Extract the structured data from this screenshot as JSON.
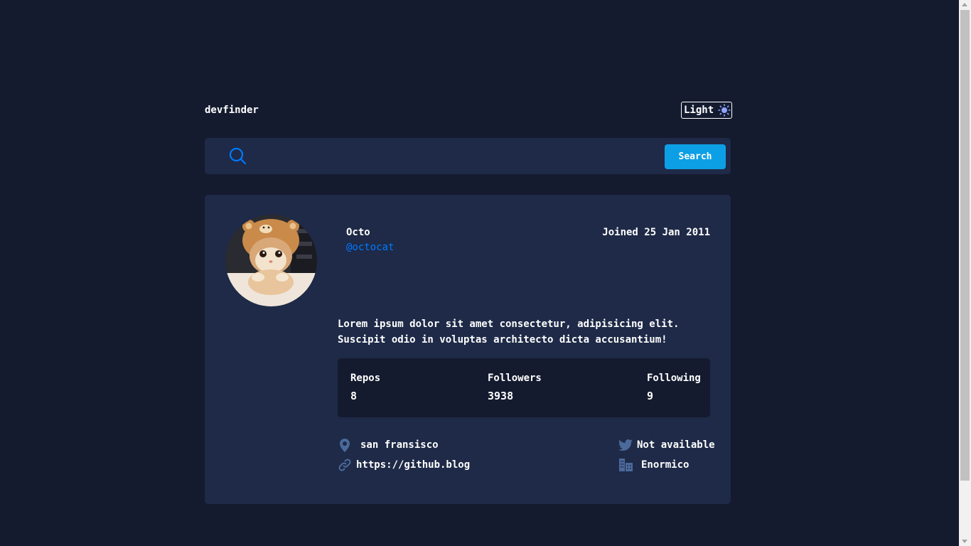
{
  "header": {
    "logo": "devfinder",
    "theme_toggle_label": "Light"
  },
  "search": {
    "value": "",
    "placeholder": "",
    "button_label": "Search"
  },
  "profile": {
    "name": "Octo",
    "login": "@octocat",
    "joined": "Joined 25 Jan 2011",
    "bio": "Lorem ipsum dolor sit amet consectetur, adipisicing elit. Suscipit odio in voluptas architecto dicta accusantium!",
    "stats": {
      "repos_label": "Repos",
      "repos_value": "8",
      "followers_label": "Followers",
      "followers_value": "3938",
      "following_label": "Following",
      "following_value": "9"
    },
    "links": {
      "location": "san fransisco",
      "blog": "https://github.blog",
      "twitter": "Not available",
      "company": "Enormico"
    }
  },
  "colors": {
    "background": "#141b2f",
    "card": "#1e2a47",
    "accent": "#0079ff",
    "button": "#0d9fe6",
    "icon": "#4b6a9b"
  },
  "icons": {
    "search": "search-icon",
    "theme": "sun-icon",
    "location": "location-pin-icon",
    "blog": "link-icon",
    "twitter": "twitter-icon",
    "company": "building-icon"
  }
}
